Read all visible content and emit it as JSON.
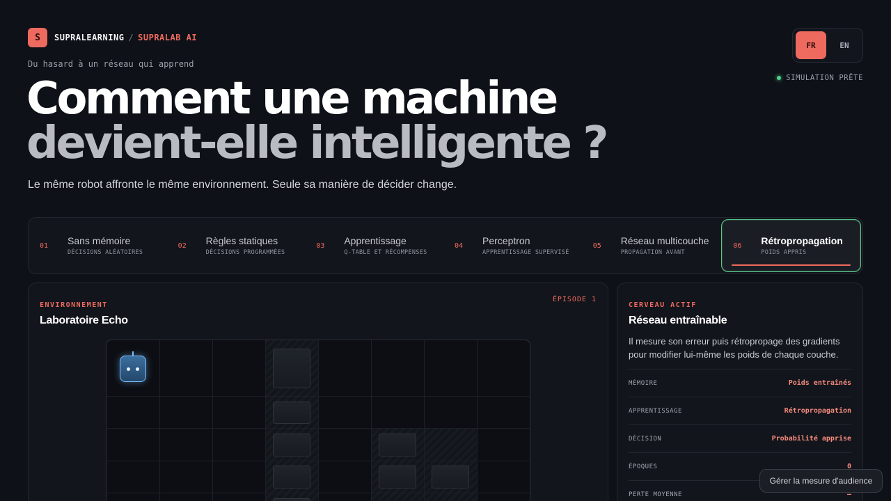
{
  "brand": {
    "logo_letter": "S",
    "name": "SUPRALEARNING",
    "separator": "/",
    "lab": "SUPRALAB AI"
  },
  "tagline": "Du hasard à un réseau qui apprend",
  "headline": {
    "strong": "Comment une machine ",
    "soft": "devient-elle intelligente ?"
  },
  "subtitle": "Le même robot affronte le même environnement. Seule sa manière de décider change.",
  "language": {
    "options": [
      "FR",
      "EN"
    ],
    "selected": "FR"
  },
  "status": {
    "label": "SIMULATION PRÊTE",
    "color": "#4fd08a"
  },
  "stages": [
    {
      "num": "01",
      "title": "Sans mémoire",
      "sub": "DÉCISIONS ALÉATOIRES",
      "active": false
    },
    {
      "num": "02",
      "title": "Règles statiques",
      "sub": "DÉCISIONS PROGRAMMÉES",
      "active": false
    },
    {
      "num": "03",
      "title": "Apprentissage",
      "sub": "Q-TABLE ET RÉCOMPENSES",
      "active": false
    },
    {
      "num": "04",
      "title": "Perceptron",
      "sub": "APPRENTISSAGE SUPERVISÉ",
      "active": false
    },
    {
      "num": "05",
      "title": "Réseau multicouche",
      "sub": "PROPAGATION AVANT",
      "active": false
    },
    {
      "num": "06",
      "title": "Rétropropagation",
      "sub": "POIDS APPRIS",
      "active": true
    }
  ],
  "environment": {
    "kicker": "ENVIRONNEMENT",
    "title": "Laboratoire Echo",
    "episode": "ÉPISODE 1"
  },
  "brain": {
    "kicker": "CERVEAU ACTIF",
    "title": "Réseau entraînable",
    "description": "Il mesure son erreur puis rétropropage des gradients pour modifier lui-même les poids de chaque couche.",
    "stats": [
      {
        "label": "MÉMOIRE",
        "value": "Poids entraînés"
      },
      {
        "label": "APPRENTISSAGE",
        "value": "Rétropropagation"
      },
      {
        "label": "DÉCISION",
        "value": "Probabilité apprise"
      },
      {
        "label": "ÉPOQUES",
        "value": "0"
      },
      {
        "label": "PERTE MOYENNE",
        "value": "—"
      }
    ]
  },
  "audience_button": "Gérer la mesure d'audience",
  "colors": {
    "accent": "#ee6a5f",
    "active_border": "#5bc48a",
    "robot": "#7cc0ff"
  }
}
